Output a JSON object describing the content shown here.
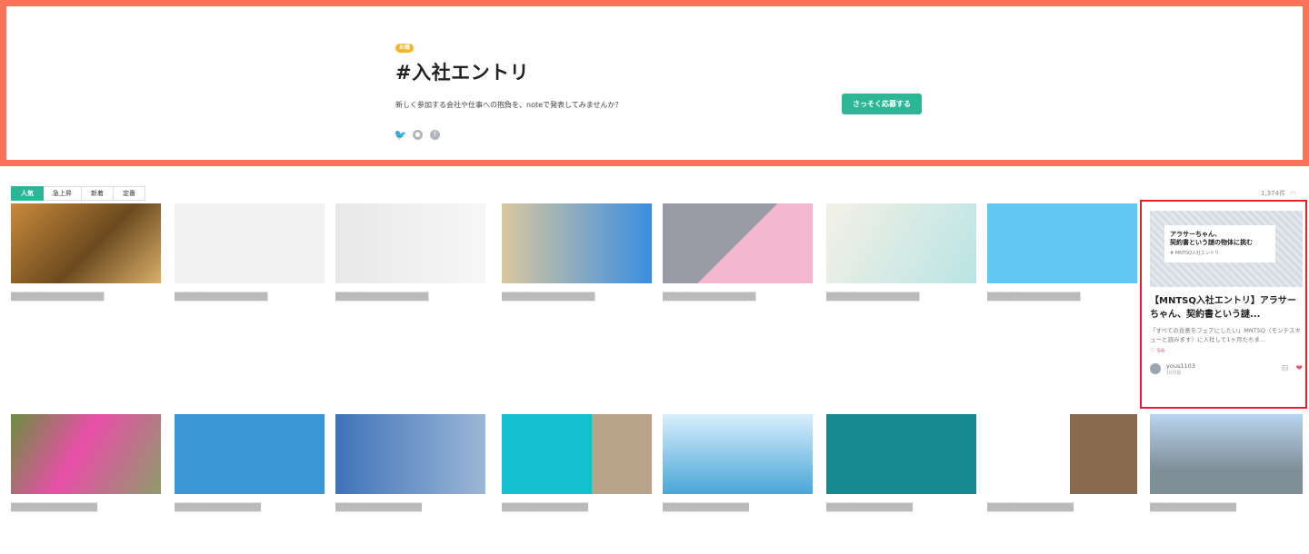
{
  "hero": {
    "badge": "お題",
    "title": "#入社エントリ",
    "description": "新しく参加する会社や仕事への抱負を、noteで発表してみませんか？",
    "apply_label": "さっそく応募する",
    "share_icons": [
      "twitter-icon",
      "line-icon",
      "facebook-icon"
    ]
  },
  "tabs": [
    {
      "label": "人気",
      "active": true
    },
    {
      "label": "急上昇",
      "active": false
    },
    {
      "label": "新着",
      "active": false
    },
    {
      "label": "定番",
      "active": false
    }
  ],
  "count": "1,374件",
  "featured": {
    "thumb_lines": [
      "アラサーちゃん、",
      "契約書という謎の物体に挑む",
      "# MNTSQ入社エントリ"
    ],
    "title": "【MNTSQ入社エントリ】アラサーちゃん、契約書という謎...",
    "excerpt": "「すべての合意をフェアにしたい」MNTSQ（モンテスキューと読みます）に入社して1ヶ月たちま...",
    "likes": "56",
    "author": "yous1103",
    "date": "10日前"
  },
  "colors": {
    "accent": "#2cb696",
    "hero_border": "#f9735b",
    "badge": "#f1b52d",
    "heart": "#e2566b",
    "highlight": "#e8202a"
  }
}
